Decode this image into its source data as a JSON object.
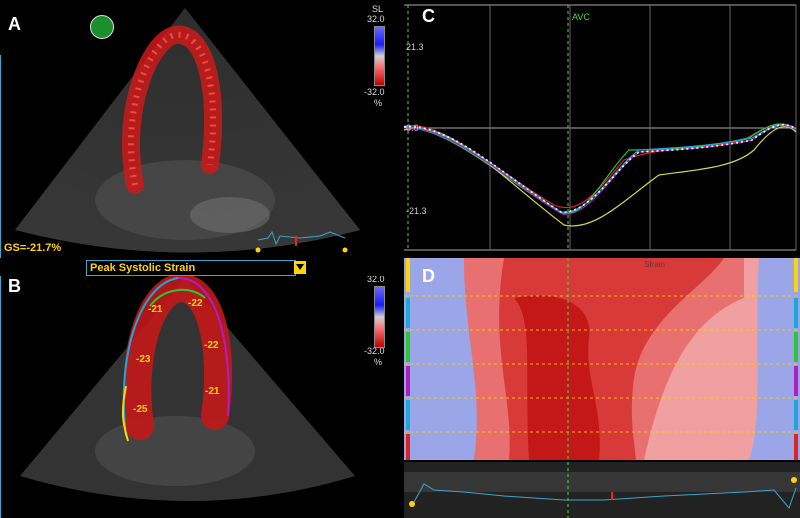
{
  "panels": {
    "a": {
      "label": "A",
      "scale_name": "SL",
      "scale_max": "32.0",
      "scale_min": "-32.0",
      "scale_unit": "%",
      "gs": "GS=-21.7%"
    },
    "b": {
      "label": "B",
      "scale_max": "32.0",
      "scale_min": "-32.0",
      "scale_unit": "%",
      "dropdown_value": "Peak Systolic Strain",
      "segments": [
        "-21",
        "-22",
        "-23",
        "-22",
        "-25",
        "-21"
      ]
    },
    "c": {
      "label": "C",
      "y_top": "21.3",
      "y_zero": "0.0",
      "y_bottom": "-21.3",
      "marker": "AVC"
    },
    "d": {
      "label": "D",
      "title": "Strain"
    }
  },
  "colors": {
    "accent": "#ffd400",
    "frame": "#3ba6c9",
    "avc": "#4cd64c"
  }
}
